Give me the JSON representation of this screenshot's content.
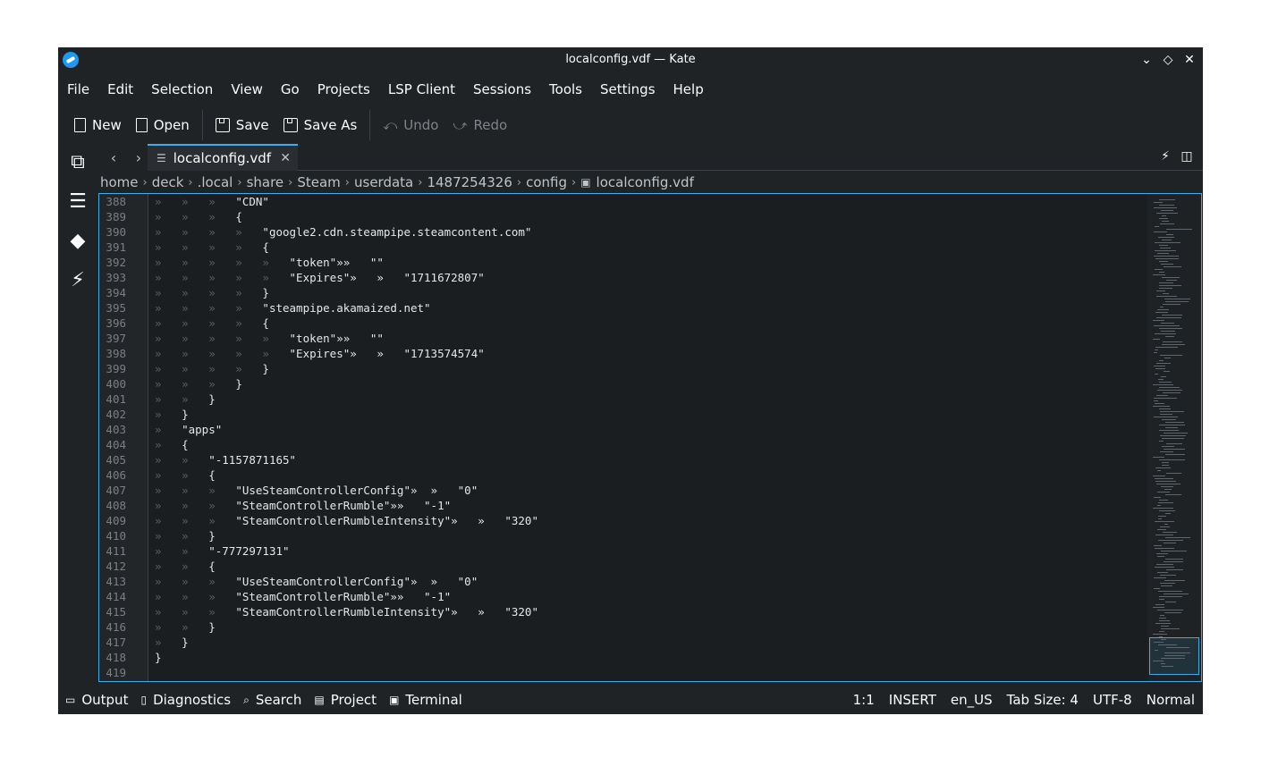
{
  "window": {
    "title": "localconfig.vdf — Kate",
    "icons": {
      "app": "kate-app-icon",
      "minimize": "chevron-down-icon",
      "maximize": "diamond-icon",
      "close": "close-icon"
    }
  },
  "menubar": {
    "items": [
      "File",
      "Edit",
      "Selection",
      "View",
      "Go",
      "Projects",
      "LSP Client",
      "Sessions",
      "Tools",
      "Settings",
      "Help"
    ]
  },
  "toolbar": {
    "new_label": "New",
    "open_label": "Open",
    "save_label": "Save",
    "save_as_label": "Save As",
    "undo_label": "Undo",
    "redo_label": "Redo"
  },
  "tab": {
    "filename": "localconfig.vdf"
  },
  "breadcrumb": {
    "segments": [
      "home",
      "deck",
      ".local",
      "share",
      "Steam",
      "userdata",
      "1487254326",
      "config"
    ],
    "file": "localconfig.vdf"
  },
  "editor": {
    "lines": [
      {
        "n": "388",
        "tabs": 3,
        "text": "\"CDN\""
      },
      {
        "n": "389",
        "tabs": 3,
        "text": "{"
      },
      {
        "n": "390",
        "tabs": 4,
        "text": "\"google2.cdn.steampipe.steamcontent.com\""
      },
      {
        "n": "391",
        "tabs": 4,
        "text": "{"
      },
      {
        "n": "392",
        "tabs": 5,
        "text": "\"token\"»»   \"\""
      },
      {
        "n": "393",
        "tabs": 5,
        "text": "\"Expires\"»   »   \"1711672807\""
      },
      {
        "n": "394",
        "tabs": 4,
        "text": "}"
      },
      {
        "n": "395",
        "tabs": 4,
        "text": "\"steampipe.akamaized.net\""
      },
      {
        "n": "396",
        "tabs": 4,
        "text": "{"
      },
      {
        "n": "397",
        "tabs": 5,
        "text": "\"token\"»»   \"\""
      },
      {
        "n": "398",
        "tabs": 5,
        "text": "\"Expires\"»   »   \"1713574574\""
      },
      {
        "n": "399",
        "tabs": 4,
        "text": "}"
      },
      {
        "n": "400",
        "tabs": 3,
        "text": "}"
      },
      {
        "n": "401",
        "tabs": 2,
        "text": "}"
      },
      {
        "n": "402",
        "tabs": 1,
        "text": "}"
      },
      {
        "n": "403",
        "tabs": 1,
        "text": "\"apps\""
      },
      {
        "n": "404",
        "tabs": 1,
        "text": "{"
      },
      {
        "n": "405",
        "tabs": 2,
        "text": "\"-1157871165\""
      },
      {
        "n": "406",
        "tabs": 2,
        "text": "{"
      },
      {
        "n": "407",
        "tabs": 3,
        "text": "\"UseSteamControllerConfig\"»  »   \"0\""
      },
      {
        "n": "408",
        "tabs": 3,
        "text": "\"SteamControllerRumble\"»»   \"-1\""
      },
      {
        "n": "409",
        "tabs": 3,
        "text": "\"SteamControllerRumbleIntensity\"»   »   \"320\""
      },
      {
        "n": "410",
        "tabs": 2,
        "text": "}"
      },
      {
        "n": "411",
        "tabs": 2,
        "text": "\"-777297131\""
      },
      {
        "n": "412",
        "tabs": 2,
        "text": "{"
      },
      {
        "n": "413",
        "tabs": 3,
        "text": "\"UseSteamControllerConfig\"»  »   \"0\""
      },
      {
        "n": "414",
        "tabs": 3,
        "text": "\"SteamControllerRumble\"»»   \"-1\""
      },
      {
        "n": "415",
        "tabs": 3,
        "text": "\"SteamControllerRumbleIntensity\"»   »   \"320\""
      },
      {
        "n": "416",
        "tabs": 2,
        "text": "}"
      },
      {
        "n": "417",
        "tabs": 1,
        "text": "}"
      },
      {
        "n": "418",
        "tabs": 0,
        "text": "}"
      },
      {
        "n": "419",
        "tabs": 0,
        "text": ""
      }
    ]
  },
  "bottom_panel": {
    "output_label": "Output",
    "diagnostics_label": "Diagnostics",
    "search_label": "Search",
    "project_label": "Project",
    "terminal_label": "Terminal"
  },
  "status": {
    "cursor": "1:1",
    "mode": "INSERT",
    "language": "en_US",
    "tab_size": "Tab Size: 4",
    "encoding": "UTF-8",
    "input_mode": "Normal"
  },
  "colors": {
    "accent": "#3daee9",
    "window_bg": "#202326",
    "editor_bg": "#1b1e20"
  }
}
